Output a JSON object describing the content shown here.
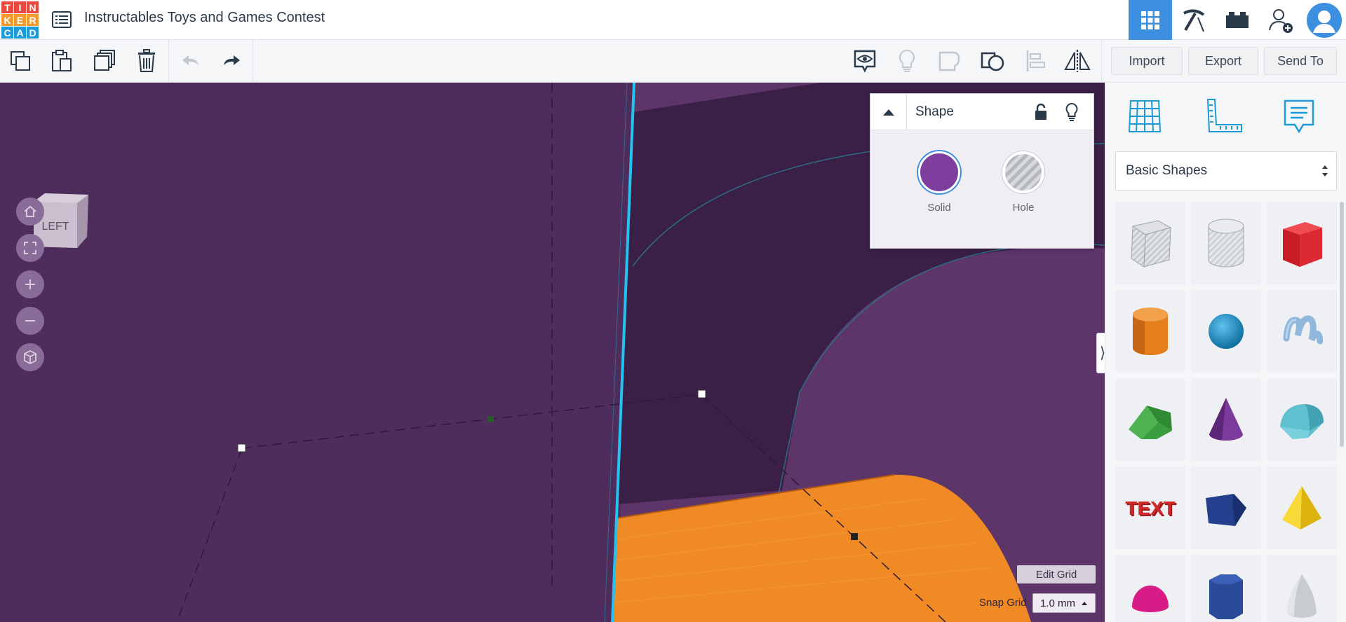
{
  "app": {
    "logo_letters": [
      "T",
      "I",
      "N",
      "K",
      "E",
      "R",
      "C",
      "A",
      "D"
    ],
    "logo_colors": [
      "#e8483e",
      "#e8483e",
      "#e8483e",
      "#f19a30",
      "#f19a30",
      "#f19a30",
      "#1d9bd9",
      "#1d9bd9",
      "#1d9bd9"
    ],
    "title": "Instructables Toys and Games Contest"
  },
  "colors": {
    "accent": "#3d8fe0",
    "workplane": "#4e2d5c",
    "shape_orange": "#f08a24",
    "solid_purple": "#7d3e9d",
    "selection_cyan": "#22c3ee"
  },
  "topbar": {
    "icons": [
      "grid-view-icon",
      "pickaxe-icon",
      "bricks-icon",
      "add-user-icon",
      "avatar-icon"
    ]
  },
  "toolbar": {
    "tools": [
      "copy-icon",
      "paste-icon",
      "duplicate-icon",
      "delete-icon",
      "undo-icon",
      "redo-icon"
    ],
    "view_tools": [
      "show-hide-icon",
      "light-bulb-icon",
      "group-icon",
      "ungroup-icon",
      "align-icon",
      "mirror-icon"
    ],
    "import_label": "Import",
    "export_label": "Export",
    "send_to_label": "Send To"
  },
  "viewcube": {
    "face_label": "LEFT"
  },
  "nav": [
    "home-icon",
    "fit-view-icon",
    "zoom-in-icon",
    "zoom-out-icon",
    "perspective-icon"
  ],
  "shape_panel": {
    "title": "Shape",
    "solid_label": "Solid",
    "hole_label": "Hole"
  },
  "grid": {
    "edit_label": "Edit Grid",
    "snap_label": "Snap Grid",
    "snap_value": "1.0 mm"
  },
  "right_panel": {
    "tabs": [
      "workplane-grid-icon",
      "ruler-icon",
      "notes-icon"
    ],
    "category": "Basic Shapes",
    "shapes": [
      {
        "name": "box-hole",
        "color": "#b8bcc4"
      },
      {
        "name": "cylinder-hole",
        "color": "#c6c9cf"
      },
      {
        "name": "box",
        "color": "#d8232c"
      },
      {
        "name": "cylinder",
        "color": "#e67e1c"
      },
      {
        "name": "sphere",
        "color": "#1a93c9"
      },
      {
        "name": "scribble",
        "color": "#8fb8dc"
      },
      {
        "name": "roof",
        "color": "#3a9e3f"
      },
      {
        "name": "cone",
        "color": "#7c3a9a"
      },
      {
        "name": "round-roof",
        "color": "#5fc0cf"
      },
      {
        "name": "text",
        "color": "#d22a2a"
      },
      {
        "name": "wedge",
        "color": "#23408e"
      },
      {
        "name": "pyramid",
        "color": "#f2cc1a"
      },
      {
        "name": "half-sphere",
        "color": "#d81b86"
      },
      {
        "name": "polygon",
        "color": "#2a4a9a"
      },
      {
        "name": "paraboloid",
        "color": "#c8cbd0"
      }
    ]
  }
}
